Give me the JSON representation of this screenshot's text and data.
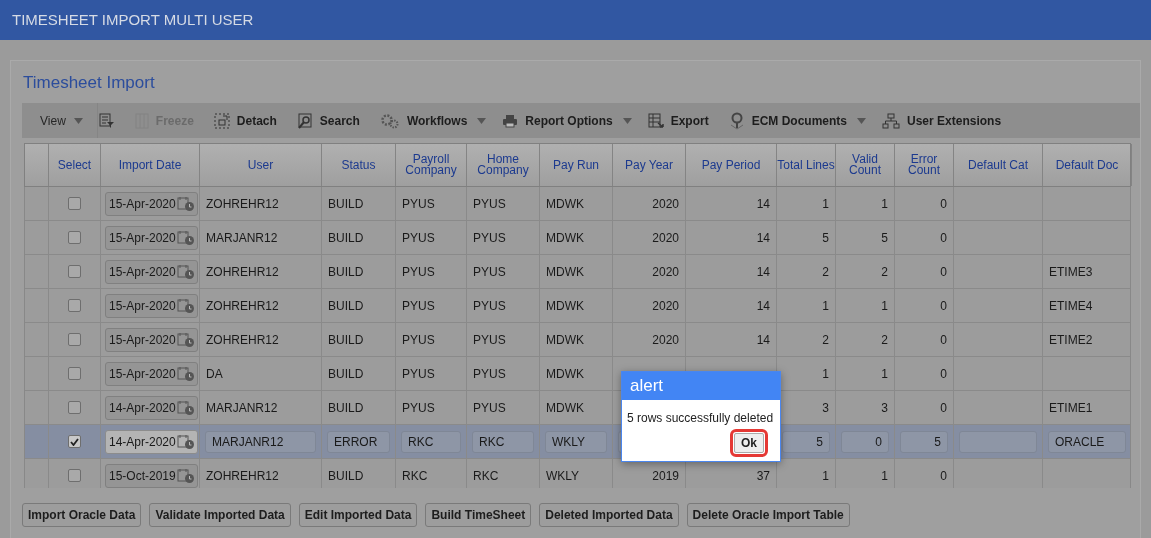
{
  "app_bar": {
    "title": "TIMESHEET IMPORT MULTI USER"
  },
  "panel": {
    "title": "Timesheet Import"
  },
  "toolbar": [
    {
      "kind": "menu",
      "label": "View",
      "dropdown": true,
      "disabled": false
    },
    {
      "kind": "filter",
      "dropdown": false,
      "disabled": false
    },
    {
      "kind": "freeze",
      "label": "Freeze",
      "dropdown": false,
      "disabled": true
    },
    {
      "kind": "detach",
      "label": "Detach",
      "dropdown": false,
      "disabled": false
    },
    {
      "kind": "search",
      "label": "Search",
      "dropdown": false,
      "disabled": false
    },
    {
      "kind": "gears",
      "label": "Workflows",
      "dropdown": true,
      "disabled": false
    },
    {
      "kind": "printer",
      "label": "Report Options",
      "dropdown": true,
      "disabled": false
    },
    {
      "kind": "export",
      "label": "Export",
      "dropdown": false,
      "disabled": false
    },
    {
      "kind": "pin",
      "label": "ECM Documents",
      "dropdown": true,
      "disabled": false
    },
    {
      "kind": "hierarchy",
      "label": "User Extensions",
      "dropdown": false,
      "disabled": false
    }
  ],
  "table": {
    "columns": [
      "Select",
      "Import Date",
      "User",
      "Status",
      "Payroll Company",
      "Home Company",
      "Pay Run",
      "Pay Year",
      "Pay Period",
      "Total Lines",
      "Valid Count",
      "Error Count",
      "Default Cat",
      "Default Doc"
    ],
    "rows": [
      {
        "checked": false,
        "selected": false,
        "editable": false,
        "import_date": "15-Apr-2020",
        "user": "ZOHREHR12",
        "status": "BUILD",
        "payroll_company": "PYUS",
        "home_company": "PYUS",
        "pay_run": "MDWK",
        "pay_year": "2020",
        "pay_period": "14",
        "total_lines": "1",
        "valid_count": "1",
        "error_count": "0"
      },
      {
        "checked": false,
        "selected": false,
        "editable": false,
        "import_date": "15-Apr-2020",
        "user": "MARJANR12",
        "status": "BUILD",
        "payroll_company": "PYUS",
        "home_company": "PYUS",
        "pay_run": "MDWK",
        "pay_year": "2020",
        "pay_period": "14",
        "total_lines": "5",
        "valid_count": "5",
        "error_count": "0"
      },
      {
        "checked": false,
        "selected": false,
        "editable": false,
        "import_date": "15-Apr-2020",
        "user": "ZOHREHR12",
        "status": "BUILD",
        "payroll_company": "PYUS",
        "home_company": "PYUS",
        "pay_run": "MDWK",
        "pay_year": "2020",
        "pay_period": "14",
        "total_lines": "2",
        "valid_count": "2",
        "error_count": "0",
        "default_doc": "ETIME3"
      },
      {
        "checked": false,
        "selected": false,
        "editable": false,
        "import_date": "15-Apr-2020",
        "user": "ZOHREHR12",
        "status": "BUILD",
        "payroll_company": "PYUS",
        "home_company": "PYUS",
        "pay_run": "MDWK",
        "pay_year": "2020",
        "pay_period": "14",
        "total_lines": "1",
        "valid_count": "1",
        "error_count": "0",
        "default_doc": "ETIME4"
      },
      {
        "checked": false,
        "selected": false,
        "editable": false,
        "import_date": "15-Apr-2020",
        "user": "ZOHREHR12",
        "status": "BUILD",
        "payroll_company": "PYUS",
        "home_company": "PYUS",
        "pay_run": "MDWK",
        "pay_year": "2020",
        "pay_period": "14",
        "total_lines": "2",
        "valid_count": "2",
        "error_count": "0",
        "default_doc": "ETIME2"
      },
      {
        "checked": false,
        "selected": false,
        "editable": false,
        "import_date": "15-Apr-2020",
        "user": "DA",
        "status": "BUILD",
        "payroll_company": "PYUS",
        "home_company": "PYUS",
        "pay_run": "MDWK",
        "total_lines": "1",
        "valid_count": "1",
        "error_count": "0"
      },
      {
        "checked": false,
        "selected": false,
        "editable": false,
        "import_date": "14-Apr-2020",
        "user": "MARJANR12",
        "status": "BUILD",
        "payroll_company": "PYUS",
        "home_company": "PYUS",
        "pay_run": "MDWK",
        "total_lines": "3",
        "valid_count": "3",
        "error_count": "0",
        "default_doc": "ETIME1"
      },
      {
        "checked": true,
        "selected": true,
        "editable": true,
        "import_date": "14-Apr-2020",
        "user": "MARJANR12",
        "status": "ERROR",
        "payroll_company": "RKC",
        "home_company": "RKC",
        "pay_run": "WKLY",
        "total_lines": "5",
        "valid_count": "0",
        "error_count": "5",
        "default_doc": "ORACLE"
      },
      {
        "checked": false,
        "selected": false,
        "editable": false,
        "import_date": "15-Oct-2019",
        "user": "ZOHREHR12",
        "status": "BUILD",
        "payroll_company": "RKC",
        "home_company": "RKC",
        "pay_run": "WKLY",
        "pay_year": "2019",
        "pay_period": "37",
        "total_lines": "1",
        "valid_count": "1",
        "error_count": "0"
      }
    ]
  },
  "actions": [
    "Import Oracle Data",
    "Validate Imported Data",
    "Edit Imported Data",
    "Build TimeSheet",
    "Deleted Imported Data",
    "Delete Oracle Import Table"
  ],
  "alert": {
    "title": "alert",
    "message": "5 rows successfully deleted",
    "button": {
      "label": "Ok",
      "focused": true
    }
  }
}
